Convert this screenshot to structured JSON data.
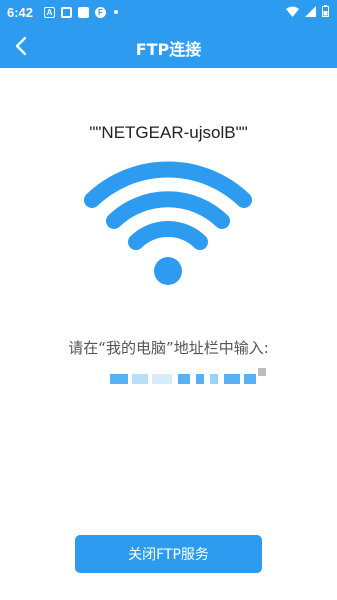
{
  "status_bar": {
    "time": "6:42",
    "icons_left": [
      "a-icon",
      "square-icon",
      "square-icon",
      "f-icon",
      "dot-icon"
    ],
    "icons_right": [
      "wifi-icon",
      "signal-icon",
      "battery-icon"
    ]
  },
  "app_bar": {
    "title": "FTP连接",
    "background": "#2d9cf0",
    "back_icon": "chevron-left-icon"
  },
  "main": {
    "network_name": "\"\"NETGEAR-ujsolB\"\"",
    "wifi_icon_color": "#2d9cf0",
    "instruction": "请在“我的电脑”地址栏中输入:"
  },
  "footer": {
    "close_button_label": "关闭FTP服务"
  }
}
